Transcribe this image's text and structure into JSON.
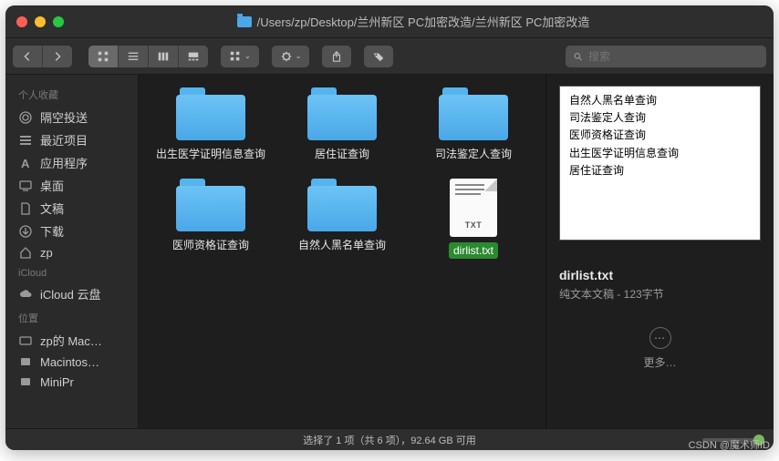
{
  "title_path": "/Users/zp/Desktop/兰州新区 PC加密改造/兰州新区 PC加密改造",
  "search_placeholder": "搜索",
  "sidebar": {
    "groups": [
      {
        "title": "个人收藏",
        "items": [
          {
            "name": "airdrop",
            "label": "隔空投送"
          },
          {
            "name": "recents",
            "label": "最近项目"
          },
          {
            "name": "apps",
            "label": "应用程序"
          },
          {
            "name": "desktop",
            "label": "桌面"
          },
          {
            "name": "documents",
            "label": "文稿"
          },
          {
            "name": "downloads",
            "label": "下载"
          },
          {
            "name": "home-zp",
            "label": "zp"
          }
        ]
      },
      {
        "title": "iCloud",
        "items": [
          {
            "name": "icloud-drive",
            "label": "iCloud 云盘"
          }
        ]
      },
      {
        "title": "位置",
        "items": [
          {
            "name": "loc-zp-mac",
            "label": "zp的 Mac…"
          },
          {
            "name": "loc-macintos",
            "label": "Macintos…"
          },
          {
            "name": "loc-minipr",
            "label": "MiniPr"
          }
        ]
      }
    ]
  },
  "files": [
    {
      "kind": "folder",
      "label": "出生医学证明信息查询"
    },
    {
      "kind": "folder",
      "label": "居住证查询"
    },
    {
      "kind": "folder",
      "label": "司法鉴定人查询"
    },
    {
      "kind": "folder",
      "label": "医师资格证查询"
    },
    {
      "kind": "folder",
      "label": "自然人黑名单查询"
    },
    {
      "kind": "file",
      "label": "dirlist.txt",
      "ext": "TXT",
      "selected": true
    }
  ],
  "preview": {
    "lines": [
      "自然人黑名单查询",
      "司法鉴定人查询",
      "医师资格证查询",
      "出生医学证明信息查询",
      "居住证查询"
    ],
    "filename": "dirlist.txt",
    "meta": "纯文本文稿 - 123字节",
    "more_label": "更多…"
  },
  "statusbar": "选择了 1 项（共 6 项），92.64 GB 可用",
  "watermark": "CSDN @魔术师ID"
}
